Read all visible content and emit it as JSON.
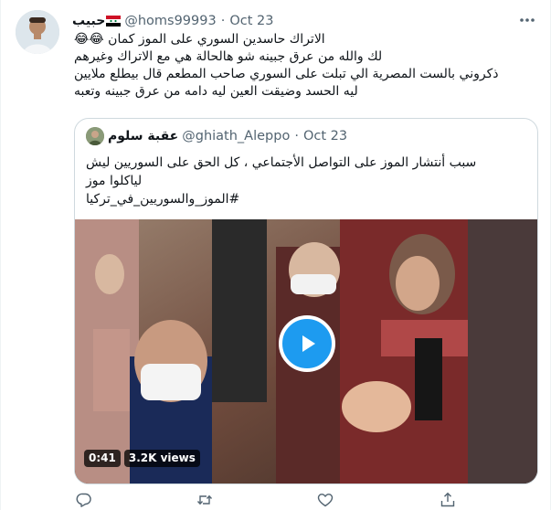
{
  "tweet": {
    "author_name": "حبيب",
    "handle": "@homs99993",
    "separator": "·",
    "date": "Oct 23",
    "text_lines": [
      "الاتراك حاسدين السوري على الموز كمان 😂😂",
      "لك والله من عرق جبينه شو هالحالة هي مع الاتراك وغيرهم",
      "ذكروني بالست المصرية الي تبلت على السوري صاحب المطعم قال بيطلع ملايين",
      "ليه الحسد وضيقت العين ليه دامه من عرق جبينه وتعبه"
    ]
  },
  "quote": {
    "author_name": "عقبة سلوم",
    "handle": "@ghiath_Aleppo",
    "separator": "·",
    "date": "Oct 23",
    "text_lines": [
      "سبب أنتشار الموز على التواصل الأجتماعي ، كل الحق على السوريين ليش",
      "لياكلوا موز"
    ],
    "hashtag": "#الموز_والسوريين_في_تركيا",
    "video": {
      "duration": "0:41",
      "views": "3.2K views"
    }
  },
  "icons": {
    "more": "more-horizontal-icon",
    "reply": "reply-icon",
    "retweet": "retweet-icon",
    "like": "like-icon",
    "share": "share-icon",
    "play": "play-icon"
  },
  "colors": {
    "accent": "#1d9bf0",
    "secondary_text": "#536471",
    "border": "#cfd9de"
  }
}
